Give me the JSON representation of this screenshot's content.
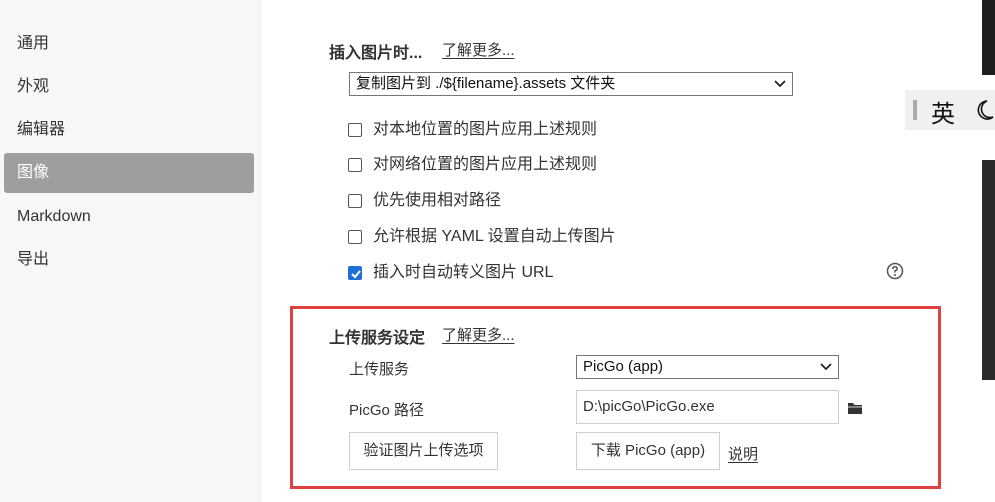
{
  "sidebar": {
    "items": [
      {
        "label": "通用"
      },
      {
        "label": "外观"
      },
      {
        "label": "编辑器"
      },
      {
        "label": "图像",
        "active": true
      },
      {
        "label": "Markdown"
      },
      {
        "label": "导出"
      }
    ]
  },
  "insert_section": {
    "title": "插入图片时...",
    "learn_more": "了解更多...",
    "action_select": {
      "value": "复制图片到 ./${filename}.assets 文件夹"
    },
    "checkboxes": [
      {
        "label": "对本地位置的图片应用上述规则",
        "checked": false
      },
      {
        "label": "对网络位置的图片应用上述规则",
        "checked": false
      },
      {
        "label": "优先使用相对路径",
        "checked": false
      },
      {
        "label": "允许根据 YAML 设置自动上传图片",
        "checked": false
      },
      {
        "label": "插入时自动转义图片 URL",
        "checked": true
      }
    ]
  },
  "upload_section": {
    "title": "上传服务设定",
    "learn_more": "了解更多...",
    "service_label": "上传服务",
    "service_value": "PicGo (app)",
    "path_label": "PicGo 路径",
    "path_value": "D:\\picGo\\PicGo.exe",
    "verify_button": "验证图片上传选项",
    "download_button": "下载 PicGo (app)",
    "help_link": "说明"
  },
  "ime": {
    "mode": "英",
    "icons": [
      "grip-icon",
      "moon-icon"
    ]
  },
  "colors": {
    "active_nav": "#9e9e9e",
    "highlight_border": "#e04040",
    "checkbox_checked": "#1f6fd6"
  }
}
